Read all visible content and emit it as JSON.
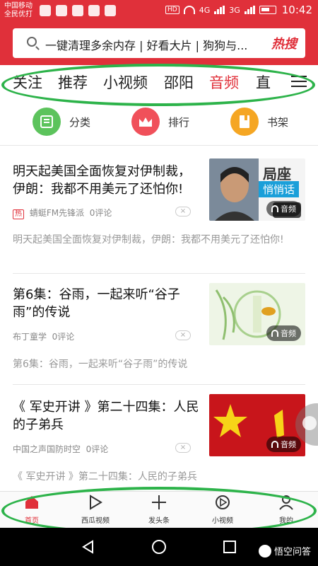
{
  "status_bar": {
    "carrier_line1": "中国移动",
    "carrier_line2": "全民优打",
    "hd": "HD",
    "net1": "4G",
    "net2": "3G",
    "time": "10:42"
  },
  "search": {
    "query": "一键清理多余内存 | 好看大片 | 狗狗与...",
    "hot_label": "热搜"
  },
  "tabs": [
    {
      "label": "关注"
    },
    {
      "label": "推荐"
    },
    {
      "label": "小视频"
    },
    {
      "label": "邵阳"
    },
    {
      "label": "音频"
    },
    {
      "label": "直"
    }
  ],
  "active_tab": "音频",
  "sub_categories": [
    {
      "label": "分类",
      "color": "#5cc35c"
    },
    {
      "label": "排行",
      "color": "#f0505a"
    },
    {
      "label": "书架",
      "color": "#f5a623"
    }
  ],
  "articles": [
    {
      "title": "明天起美国全面恢复对伊制裁，伊朗：我都不用美元了还怕你!",
      "hot_tag": "热",
      "source": "蜻蜓FM先锋派",
      "comments": "0评论",
      "desc": "明天起美国全面恢复对伊制裁，伊朗：我都不用美元了还怕你!",
      "thumb_text1": "局座",
      "thumb_text2": "悄悄话",
      "badge": "音频"
    },
    {
      "title": "第6集：谷雨，一起来听“谷子雨”的传说",
      "hot_tag": "",
      "source": "布丁童学",
      "comments": "0评论",
      "desc": "第6集：谷雨，一起来听“谷子雨”的传说",
      "badge": "音频"
    },
    {
      "title": "《 军史开讲 》第二十四集：人民的子弟兵",
      "hot_tag": "",
      "source": "中国之声国防时空",
      "comments": "0评论",
      "desc": "《 军史开讲 》第二十四集：人民的子弟兵",
      "badge": "音频"
    }
  ],
  "dislike_label": "×",
  "bottom_nav": [
    {
      "label": "首页"
    },
    {
      "label": "西瓜视频"
    },
    {
      "label": "发头条"
    },
    {
      "label": "小视频"
    },
    {
      "label": "我的"
    }
  ],
  "watermark": "悟空问答",
  "colors": {
    "brand_red": "#e0303a",
    "annotation_green": "#2db34a"
  }
}
